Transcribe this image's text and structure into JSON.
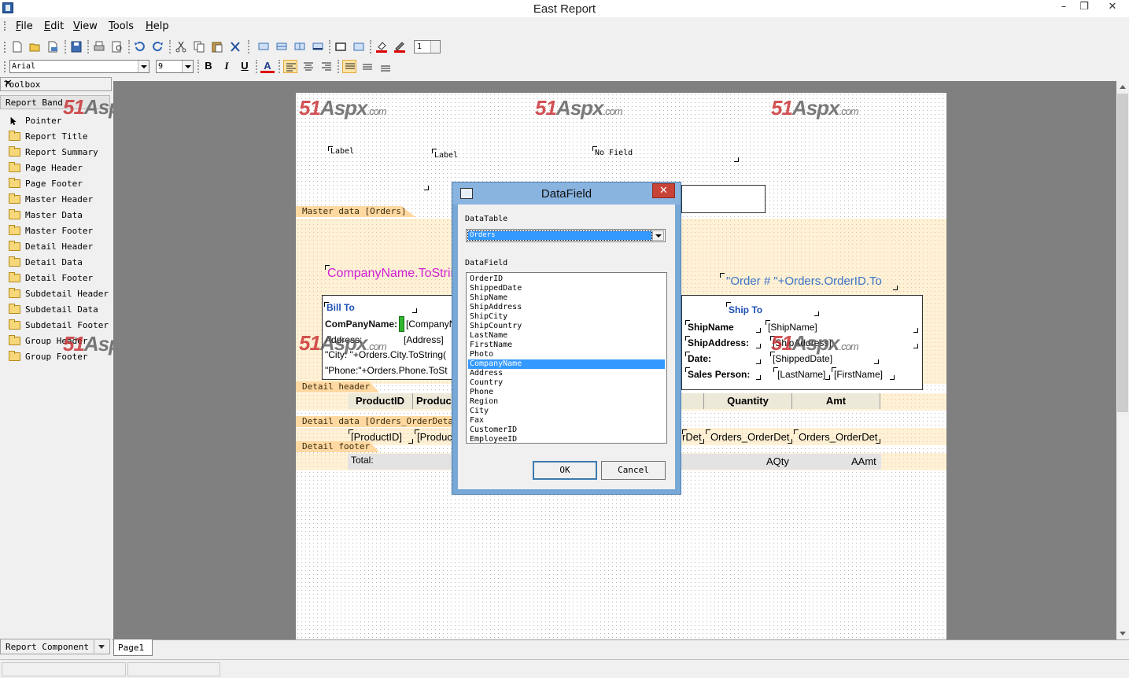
{
  "window": {
    "title": "East Report",
    "minimize": "–",
    "restore": "❐",
    "close": "✕"
  },
  "menu": [
    "File",
    "Edit",
    "View",
    "Tools",
    "Help"
  ],
  "format_bar": {
    "font": "Arial",
    "size": "9",
    "bold": "B",
    "italic": "I",
    "underline": "U",
    "font_color": "A",
    "zoom_value": "1"
  },
  "toolbox": {
    "title": "Toolbox",
    "close": "✕",
    "section": "Report Band",
    "items": [
      "Pointer",
      "Report Title",
      "Report Summary",
      "Page Header",
      "Page Footer",
      "Master Header",
      "Master Data",
      "Master Footer",
      "Detail Header",
      "Detail Data",
      "Detail Footer",
      "Subdetail Header",
      "Subdetail Data",
      "Subdetail Footer",
      "Group Header",
      "Group Footer"
    ],
    "bottom_section": "Report Component"
  },
  "watermark": {
    "main": "51",
    "mid": "Aspx",
    "suffix": ".com"
  },
  "report": {
    "title_controls": {
      "label1": "Label",
      "label2": "Label",
      "nofield": "No Field"
    },
    "bands": {
      "master_data": "Master data [Orders]",
      "detail_header": "Detail header",
      "detail_data": "Detail data [Orders_OrderDetails]",
      "detail_footer": "Detail footer"
    },
    "company_expr": "CompanyName.ToString",
    "order_expr": "\"Order # \"+Orders.OrderID.To",
    "bill_to": {
      "heading": "Bill To",
      "company_label": "ComPanyName:",
      "company_value": "[CompanyN",
      "address_label": "Address:",
      "address_value": "[Address]",
      "city_expr": "\"City:  \"+Orders.City.ToString(",
      "phone_expr": "\"Phone:\"+Orders.Phone.ToSt"
    },
    "ship_to": {
      "heading": "Ship To",
      "shipname_label": "ShipName",
      "shipname_value": "[ShipName]",
      "shipaddress_label": "ShipAddress:",
      "shipaddress_value": "[ShipAddress]",
      "date_label": "Date:",
      "date_value": "[ShippedDate]",
      "salesperson_label": "Sales Person:",
      "lastname": "[LastName]",
      "firstname": "[FirstName]"
    },
    "detail_header_cells": [
      "ProductID",
      "Produc",
      "Quantity",
      "Amt"
    ],
    "detail_data_cells": [
      "[ProductID]",
      "[Produc",
      "rDet",
      "Orders_OrderDet",
      "Orders_OrderDet"
    ],
    "footer": {
      "total": "Total:",
      "aqty": "AQty",
      "aamt": "AAmt"
    }
  },
  "dialog": {
    "title": "DataField",
    "close": "✕",
    "table_label": "DataTable",
    "table_value": "Orders",
    "field_label": "DataField",
    "fields": [
      "OrderID",
      "ShippedDate",
      "ShipName",
      "ShipAddress",
      "ShipCity",
      "ShipCountry",
      "LastName",
      "FirstName",
      "Photo",
      "CompanyName",
      "Address",
      "Country",
      "Phone",
      "Region",
      "City",
      "Fax",
      "CustomerID",
      "EmployeeID"
    ],
    "selected_field": "CompanyName",
    "ok": "OK",
    "cancel": "Cancel"
  },
  "tabs": [
    "Page1"
  ]
}
